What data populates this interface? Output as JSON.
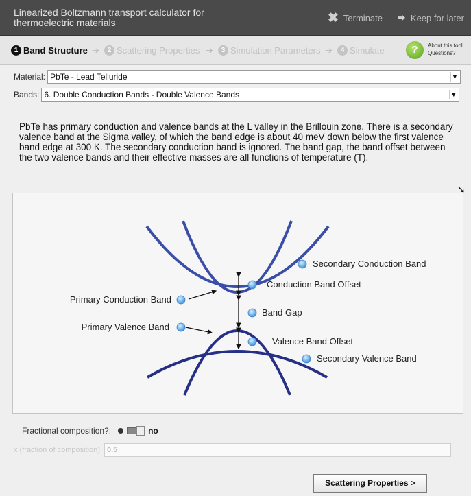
{
  "window": {
    "title": "Linearized Boltzmann transport calculator for thermoelectric materials",
    "terminate_label": "Terminate",
    "keep_label": "Keep for later"
  },
  "steps": [
    {
      "num": "1",
      "label": "Band Structure"
    },
    {
      "num": "2",
      "label": "Scattering Properties"
    },
    {
      "num": "3",
      "label": "Simulation Parameters"
    },
    {
      "num": "4",
      "label": "Simulate"
    }
  ],
  "about": {
    "line1": "About this tool",
    "line2": "Questions?"
  },
  "material": {
    "label": "Material:",
    "value": "PbTe - Lead Telluride"
  },
  "bands": {
    "label": "Bands:",
    "value": "6. Double Conduction Bands - Double Valence Bands"
  },
  "description": "PbTe has primary conduction and valence bands at the L valley in the Brillouin zone. There is a secondary valence band at the Sigma valley, of which the band edge is about 40 meV down below the first valence band edge at 300 K. The secondary conduction band is ignored. The band gap, the band offset between the two valence bands and their effective masses are all functions of temperature (T).",
  "diagram": {
    "labels": {
      "secondary_conduction": "Secondary Conduction Band",
      "conduction_offset": "Conduction Band Offset",
      "primary_conduction": "Primary Conduction Band",
      "band_gap": "Band Gap",
      "primary_valence": "Primary Valence Band",
      "valence_offset": "Valence Band Offset",
      "secondary_valence": "Secondary Valence Band"
    },
    "colors": {
      "band_primary": "#3a4ea8",
      "band_dark": "#262f86",
      "hotspot": "#5aa6e6"
    }
  },
  "fraction": {
    "label": "Fractional composition?:",
    "value": "no"
  },
  "x_field": {
    "label": "x (fraction of composition):",
    "value": "0.5"
  },
  "next_button": "Scattering Properties >"
}
